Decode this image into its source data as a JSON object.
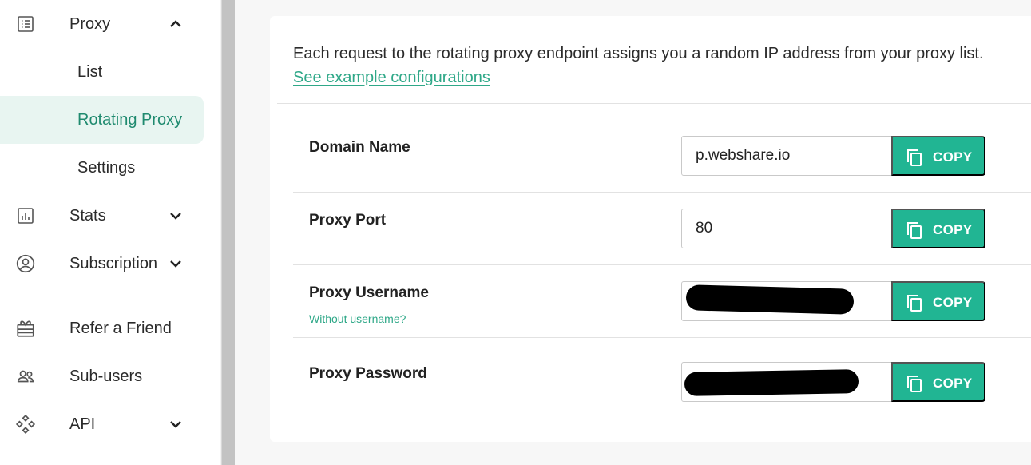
{
  "sidebar": {
    "proxy": {
      "label": "Proxy",
      "icon": "list-icon",
      "expanded": true
    },
    "sub_items": [
      {
        "label": "List"
      },
      {
        "label": "Rotating Proxy",
        "active": true
      },
      {
        "label": "Settings"
      }
    ],
    "stats": {
      "label": "Stats",
      "icon": "chart-icon"
    },
    "subscription": {
      "label": "Subscription",
      "icon": "account-circle-icon"
    },
    "refer": {
      "label": "Refer a Friend",
      "icon": "gift-icon"
    },
    "subusers": {
      "label": "Sub-users",
      "icon": "people-icon"
    },
    "api": {
      "label": "API",
      "icon": "api-icon"
    }
  },
  "main": {
    "intro_text": "Each request to the rotating proxy endpoint assigns you a random IP address from your proxy list.",
    "intro_link": "See example configurations",
    "rows": [
      {
        "label": "Domain Name",
        "value": "p.webshare.io",
        "copy_label": "COPY"
      },
      {
        "label": "Proxy Port",
        "value": "80",
        "copy_label": "COPY"
      },
      {
        "label": "Proxy Username",
        "value": "",
        "sublink": "Without username?",
        "copy_label": "COPY"
      },
      {
        "label": "Proxy Password",
        "value": "",
        "copy_label": "COPY"
      }
    ]
  },
  "colors": {
    "accent": "#21b593",
    "link": "#2fa888",
    "active_bg": "#e8f5f1"
  }
}
